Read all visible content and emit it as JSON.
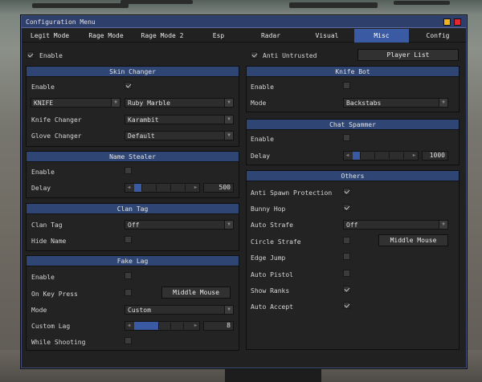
{
  "window": {
    "title": "Configuration Menu",
    "accent": "#3a5ba3",
    "min_color": "#f0b21e",
    "close_color": "#e0282e"
  },
  "tabs": [
    "Legit Mode",
    "Rage Mode",
    "Rage Mode 2",
    "Esp",
    "Radar",
    "Visual",
    "Misc",
    "Config"
  ],
  "active_tab": "Misc",
  "top": {
    "enable_label": "Enable",
    "enable_checked": true,
    "anti_untrusted_label": "Anti Untrusted",
    "anti_untrusted_checked": true,
    "player_list_label": "Player List"
  },
  "skin_changer": {
    "title": "Skin Changer",
    "enable_label": "Enable",
    "enable_checked": true,
    "weapon": "KNIFE",
    "skin": "Ruby Marble",
    "knife_label": "Knife Changer",
    "knife_value": "Karambit",
    "glove_label": "Glove Changer",
    "glove_value": "Default"
  },
  "name_stealer": {
    "title": "Name Stealer",
    "enable_label": "Enable",
    "enable_checked": false,
    "delay_label": "Delay",
    "delay_value": "500"
  },
  "clan_tag": {
    "title": "Clan Tag",
    "tag_label": "Clan Tag",
    "tag_value": "Off",
    "hide_label": "Hide Name",
    "hide_checked": false
  },
  "fake_lag": {
    "title": "Fake Lag",
    "enable_label": "Enable",
    "enable_checked": false,
    "key_label": "On Key Press",
    "key_checked": false,
    "key_button": "Middle Mouse",
    "mode_label": "Mode",
    "mode_value": "Custom",
    "custom_label": "Custom Lag",
    "custom_value": "8",
    "shooting_label": "While Shooting",
    "shooting_checked": false
  },
  "knife_bot": {
    "title": "Knife Bot",
    "enable_label": "Enable",
    "enable_checked": false,
    "mode_label": "Mode",
    "mode_value": "Backstabs"
  },
  "chat_spammer": {
    "title": "Chat Spammer",
    "enable_label": "Enable",
    "enable_checked": false,
    "delay_label": "Delay",
    "delay_value": "1000"
  },
  "others": {
    "title": "Others",
    "anti_spawn_label": "Anti Spawn Protection",
    "anti_spawn_checked": true,
    "bhop_label": "Bunny Hop",
    "bhop_checked": true,
    "autostrafe_label": "Auto Strafe",
    "autostrafe_value": "Off",
    "circle_label": "Circle Strafe",
    "circle_checked": false,
    "circle_button": "Middle Mouse",
    "edge_label": "Edge Jump",
    "edge_checked": false,
    "pistol_label": "Auto Pistol",
    "pistol_checked": false,
    "ranks_label": "Show Ranks",
    "ranks_checked": true,
    "accept_label": "Auto Accept",
    "accept_checked": true
  }
}
